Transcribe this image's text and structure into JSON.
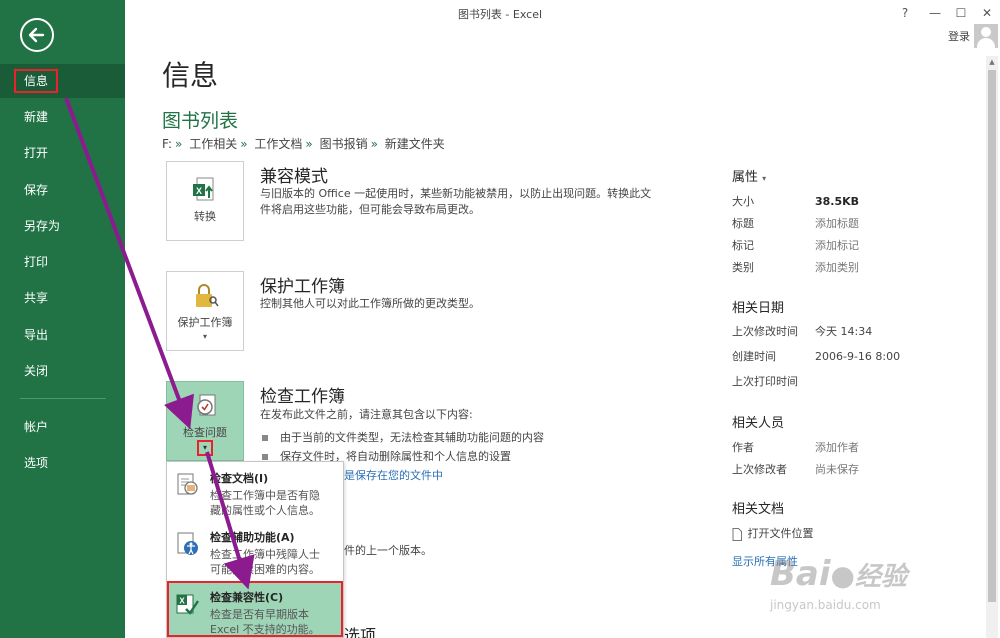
{
  "window": {
    "title": "图书列表 - Excel",
    "help": "?",
    "minimize": "—",
    "maximize": "☐",
    "close": "✕",
    "login": "登录"
  },
  "sidebar": {
    "items": [
      {
        "label": "信息",
        "active": true
      },
      {
        "label": "新建"
      },
      {
        "label": "打开"
      },
      {
        "label": "保存"
      },
      {
        "label": "另存为"
      },
      {
        "label": "打印"
      },
      {
        "label": "共享"
      },
      {
        "label": "导出"
      },
      {
        "label": "关闭"
      },
      {
        "label": "帐户"
      },
      {
        "label": "选项"
      }
    ]
  },
  "main": {
    "title": "信息",
    "doc_name": "图书列表",
    "breadcrumb": [
      "F:",
      "工作相关",
      "工作文档",
      "图书报销",
      "新建文件夹"
    ],
    "breadcrumb_sep": "»",
    "sections": {
      "compat": {
        "tile_label": "转换",
        "title": "兼容模式",
        "desc": "与旧版本的 Office 一起使用时，某些新功能被禁用，以防止出现问题。转换此文件将启用这些功能，但可能会导致布局更改。"
      },
      "protect": {
        "tile_label": "保护工作簿",
        "tile_caret": "▾",
        "title": "保护工作簿",
        "desc": "控制其他人可以对此工作簿所做的更改类型。"
      },
      "inspect": {
        "tile_label": "检查问题",
        "tile_caret": "▾",
        "title": "检查工作簿",
        "desc": "在发布此文件之前，请注意其包含以下内容:",
        "bullets": [
          "由于当前的文件类型，无法检查其辅助功能问题的内容",
          "保存文件时，将自动删除属性和个人信息的设置"
        ],
        "link": "是保存在您的文件中"
      },
      "versions": {
        "desc_tail": "件的上一个版本。"
      },
      "options_tail": "选项"
    },
    "dropdown": [
      {
        "title": "检查文档(I)",
        "desc": [
          "检查工作簿中是否有隐",
          "藏的属性或个人信息。"
        ]
      },
      {
        "title": "检查辅助功能(A)",
        "desc": [
          "检查工作簿中残障人士",
          "可能阅读困难的内容。"
        ]
      },
      {
        "title": "检查兼容性(C)",
        "desc": [
          "检查是否有早期版本",
          "Excel 不支持的功能。"
        ],
        "highlight": true
      }
    ]
  },
  "properties": {
    "heading": "属性",
    "heading_caret": "▾",
    "rows": [
      {
        "key": "大小",
        "value": "38.5KB"
      },
      {
        "key": "标题",
        "value": "添加标题"
      },
      {
        "key": "标记",
        "value": "添加标记"
      },
      {
        "key": "类别",
        "value": "添加类别"
      }
    ],
    "dates_heading": "相关日期",
    "dates": [
      {
        "key": "上次修改时间",
        "value": "今天 14:34"
      },
      {
        "key": "创建时间",
        "value": "2006-9-16 8:00"
      },
      {
        "key": "上次打印时间",
        "value": ""
      }
    ],
    "people_heading": "相关人员",
    "people": [
      {
        "key": "作者",
        "value": "添加作者"
      },
      {
        "key": "上次修改者",
        "value": "尚未保存"
      }
    ],
    "docs_heading": "相关文档",
    "open_location": "打开文件位置",
    "show_all": "显示所有属性"
  },
  "watermark": {
    "brand": "Bai",
    "brand_tail": "经验",
    "url": "jingyan.baidu.com"
  },
  "colors": {
    "sidebar_bg": "#217346",
    "accent_green": "#217346",
    "highlight_bg": "#9fd5b7",
    "annotation_red": "#e8242a",
    "arrow_purple": "#8b1b8f",
    "link_blue": "#2a6fb5"
  }
}
